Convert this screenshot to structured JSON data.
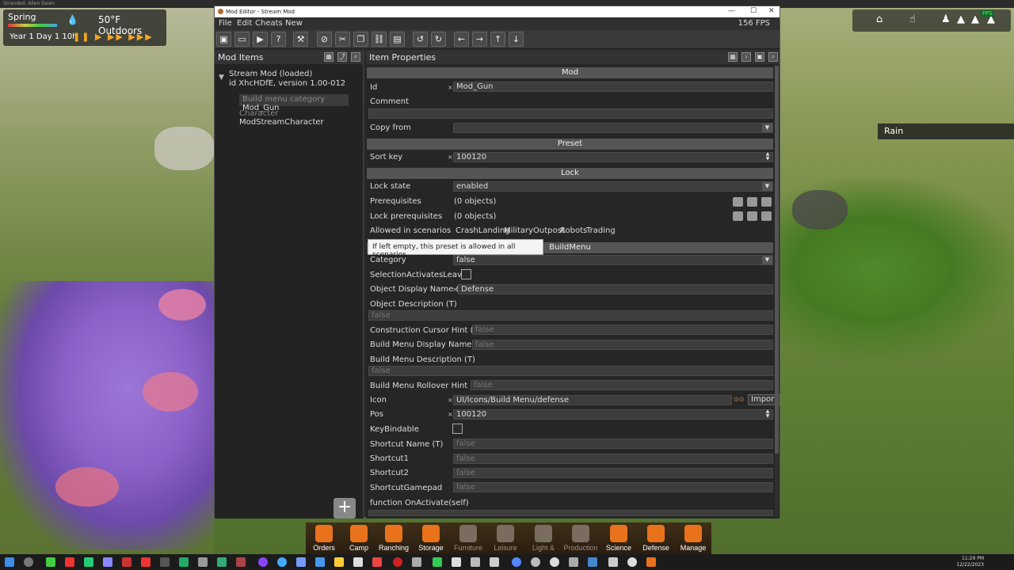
{
  "host": {
    "title": "Stranded: Alien Dawn"
  },
  "hud": {
    "season": "Spring",
    "temperature": "50°F Outdoors",
    "date": "Year 1 Day 1  10h",
    "speed_controls": "❚❚ ▶ ▶▶ ▶▶▶",
    "rain_label": "Rain"
  },
  "editor": {
    "window_title": "Mod Editor - Stream Mod",
    "fps": "156 FPS",
    "menu": [
      "File",
      "Edit",
      "Cheats",
      "New"
    ],
    "left_pane": {
      "title": "Mod Items",
      "mod_name": "Stream Mod (loaded)",
      "mod_id": "id XhcHDfE, version 1.00-012",
      "items": [
        {
          "kind": "Build menu category",
          "name": "Mod_Gun"
        },
        {
          "kind": "Character",
          "name": "ModStreamCharacter"
        }
      ]
    },
    "right_pane": {
      "title": "Item Properties",
      "sections": {
        "mod": "Mod",
        "preset": "Preset",
        "lock": "Lock",
        "buildmenu": "BuildMenu"
      },
      "props": {
        "id_label": "Id",
        "id_value": "Mod_Gun",
        "comment_label": "Comment",
        "copy_from_label": "Copy from",
        "sort_key_label": "Sort key",
        "sort_key_value": "100120",
        "lock_state_label": "Lock state",
        "lock_state_value": "enabled",
        "prereq_label": "Prerequisites",
        "prereq_value": "(0 objects)",
        "lock_prereq_label": "Lock prerequisites",
        "lock_prereq_value": "(0 objects)",
        "allowed_label": "Allowed in scenarios",
        "scenarios": [
          "CrashLanding",
          "MilitaryOutpost",
          "Robots",
          "Trading"
        ],
        "tooltip": "If left empty, this preset is allowed in all scenarios",
        "category_label": "Category",
        "category_value": "false",
        "sel_label": "SelectionActivatesLeaves",
        "odn_label": "Object Display Name (T)",
        "odn_value": "Defense",
        "odesc_label": "Object Description (T)",
        "odesc_value": "false",
        "cch_label": "Construction Cursor Hint (T)",
        "cch_value": "false",
        "bmdn_label": "Build Menu Display Name (T)",
        "bmdn_value": "false",
        "bmdesc_label": "Build Menu Description (T)",
        "bmdesc_value": "false",
        "bmrh_label": "Build Menu Rollover Hint (T)",
        "bmrh_value": "false",
        "icon_label": "Icon",
        "icon_value": "UI/Icons/Build Menu/defense",
        "import_label": "Import",
        "pos_label": "Pos",
        "pos_value": "100120",
        "keybind_label": "KeyBindable",
        "shortcut_name_label": "Shortcut Name (T)",
        "shortcut_name_value": "false",
        "shortcut1_label": "Shortcut1",
        "shortcut1_value": "false",
        "shortcut2_label": "Shortcut2",
        "shortcut2_value": "false",
        "shortcut_gp_label": "ShortcutGamepad",
        "shortcut_gp_value": "false",
        "onactivate_label": "function OnActivate(self)"
      }
    }
  },
  "game_toolbar": [
    {
      "label": "Orders",
      "active": true
    },
    {
      "label": "Camp",
      "active": true
    },
    {
      "label": "Ranching",
      "active": true
    },
    {
      "label": "Storage",
      "active": true
    },
    {
      "label": "Furniture",
      "active": false
    },
    {
      "label": "Leisure",
      "active": false
    },
    {
      "label": "Light & Heat",
      "active": false
    },
    {
      "label": "Production",
      "active": false
    },
    {
      "label": "Science",
      "active": true
    },
    {
      "label": "Defense",
      "active": true
    },
    {
      "label": "Manage",
      "active": true
    }
  ],
  "taskbar": {
    "time": "11:29 PM",
    "date": "12/22/2023"
  },
  "colors": {
    "accent": "#e8731c",
    "panel": "#262626",
    "section": "#555555"
  }
}
